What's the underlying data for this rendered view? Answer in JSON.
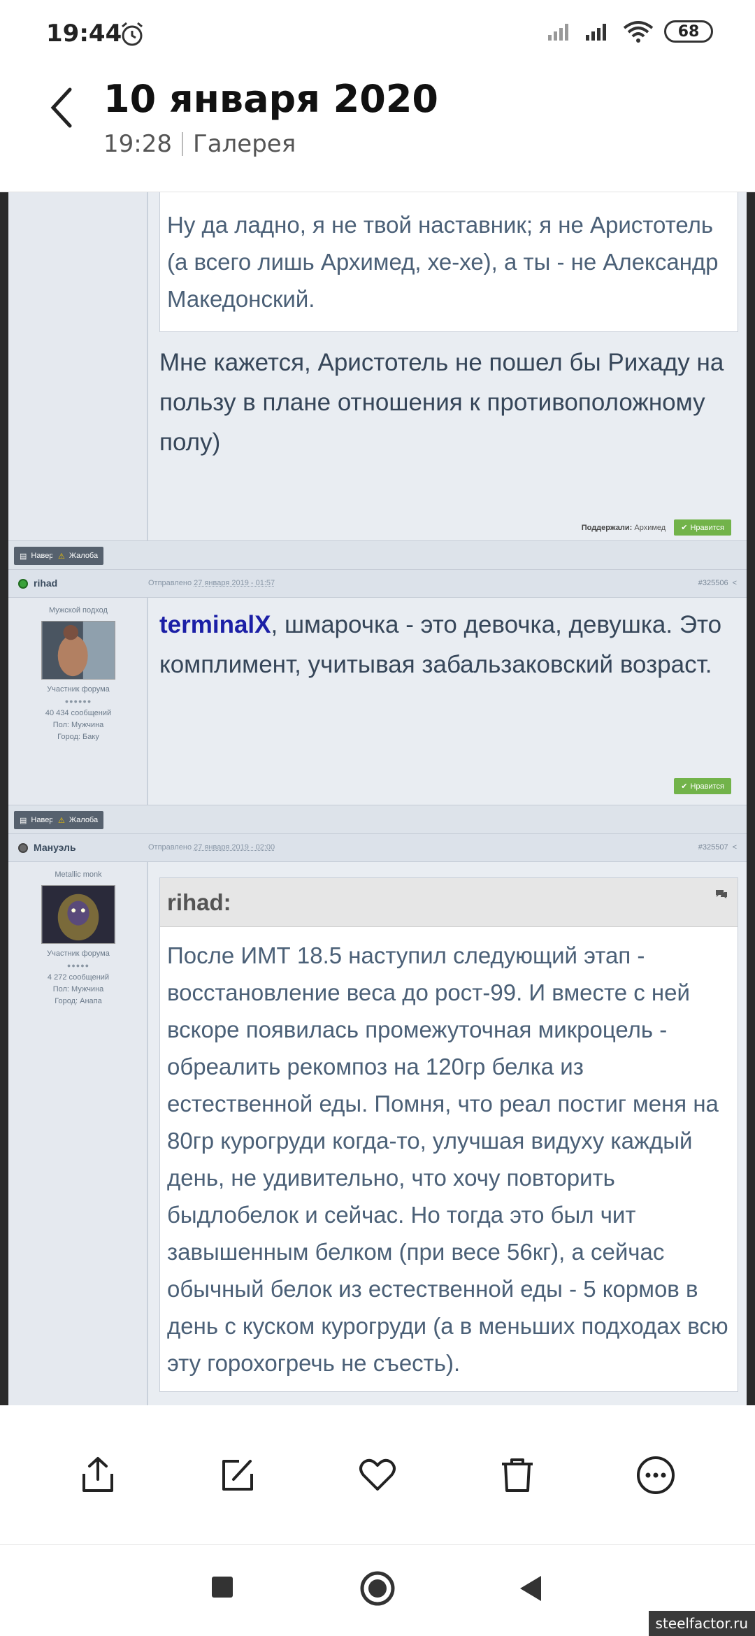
{
  "status": {
    "time": "19:44",
    "battery": "68"
  },
  "header": {
    "title": "10 января 2020",
    "time": "19:28",
    "album": "Галерея"
  },
  "posts": [
    {
      "quote": "Ну да ладно, я не твой наставник; я не Аристотель (а всего лишь Архимед, хе-хе), а ты - не Александр Македонский.",
      "text": "Мне кажется, Аристотель не пошел бы Рихаду на пользу в плане отношения к противоположному полу)",
      "liked_label": "Поддержали:",
      "liked_by": "Архимед",
      "like_label": "Нравится"
    },
    {
      "user": "rihad",
      "sent_label": "Отправлено",
      "date": "27 января 2019 - 01:57",
      "number": "#325506",
      "user_title": "Мужской подход",
      "group": "Участник форума",
      "messages": "40 434 сообщений",
      "gender_label": "Пол:",
      "gender": "Мужчина",
      "city_label": "Город:",
      "city": "Баку",
      "mention": "terminalX",
      "text": ", шмарочка - это девочка, девушка. Это комплимент, учитывая забальзаковский возраст.",
      "like_label": "Нравится"
    },
    {
      "user": "Мануэль",
      "sent_label": "Отправлено",
      "date": "27 января 2019 - 02:00",
      "number": "#325507",
      "user_title": "Metallic monk",
      "group": "Участник форума",
      "messages": "4 272 сообщений",
      "gender_label": "Пол:",
      "gender": "Мужчина",
      "city_label": "Город:",
      "city": "Анапа",
      "quote_author": "rihad:",
      "quote": "После ИМТ 18.5 наступил следующий этап - восстановление веса до рост-99. И вместе с ней вскоре появилась промежуточная микроцель - обреалить рекомпоз на 120гр белка из естественной еды. Помня, что реал постиг меня на 80гр курогруди когда-то, улучшая видуху каждый день, не удивительно, что хочу повторить быдлобелок и сейчас. Но тогда это был чит завышенным белком (при весе 56кг), а сейчас обычный белок из естественной еды - 5 кормов в день с куском курогруди (а в меньших подходах всю эту горохогречь не съесть)."
    }
  ],
  "actions": {
    "top": "Наверх",
    "report": "Жалоба"
  },
  "watermark": "steelfactor.ru"
}
